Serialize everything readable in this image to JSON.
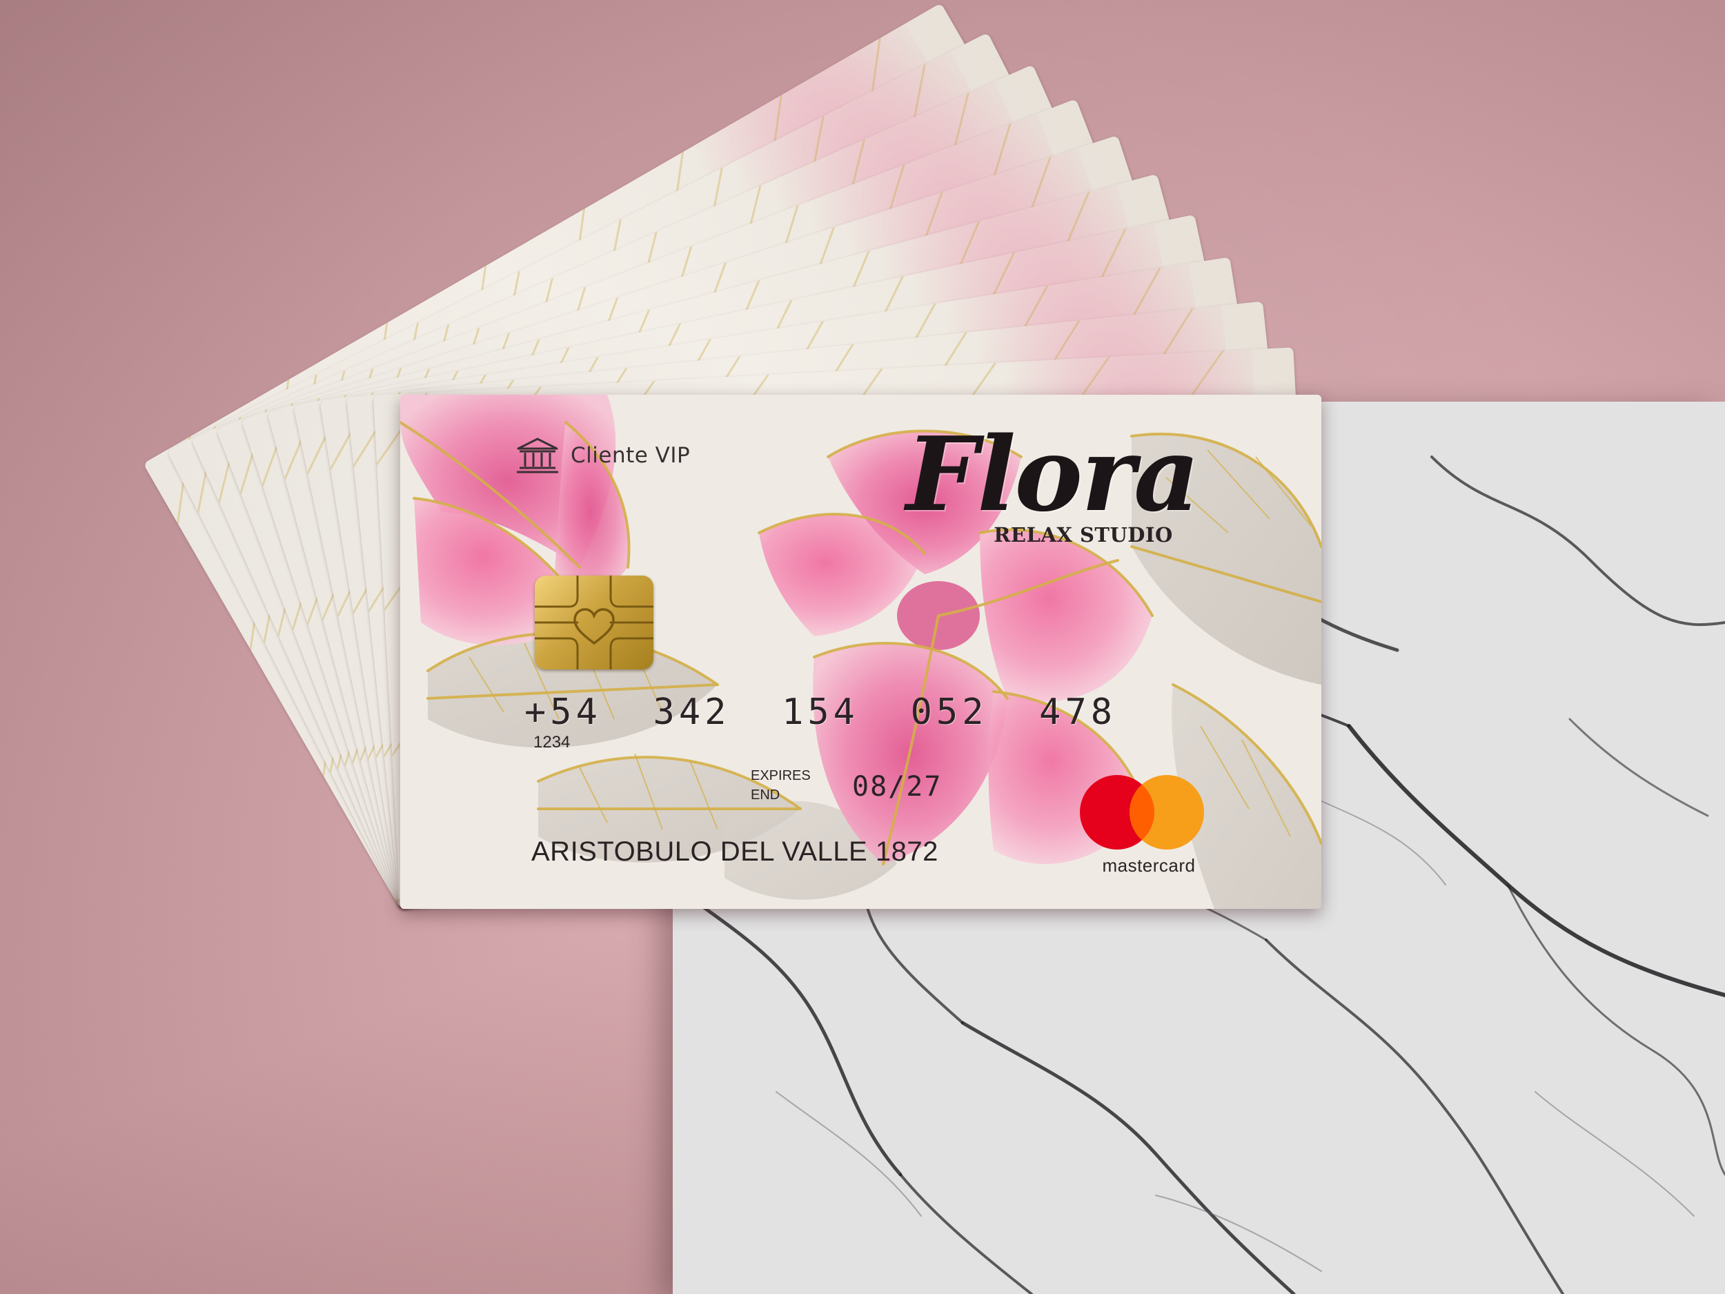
{
  "card": {
    "badge_label": "Cliente VIP",
    "badge_icon": "bank-building-icon",
    "brand_name": "Flora",
    "brand_subtitle": "RELAX STUDIO",
    "number_main": "+54  342  154  052  478",
    "number_small": "1234",
    "expires_label_1": "EXPIRES",
    "expires_label_2": "END",
    "expiry_date": "08/27",
    "address": "ARISTOBULO DEL VALLE 1872",
    "network_label": "mastercard"
  },
  "colors": {
    "background": "#c99ca1",
    "card_base": "#efebe4",
    "flower_pink": "#e97aa6",
    "gold_line": "#d4b048",
    "mastercard_red": "#e5001b",
    "mastercard_orange": "#f79e1b"
  }
}
